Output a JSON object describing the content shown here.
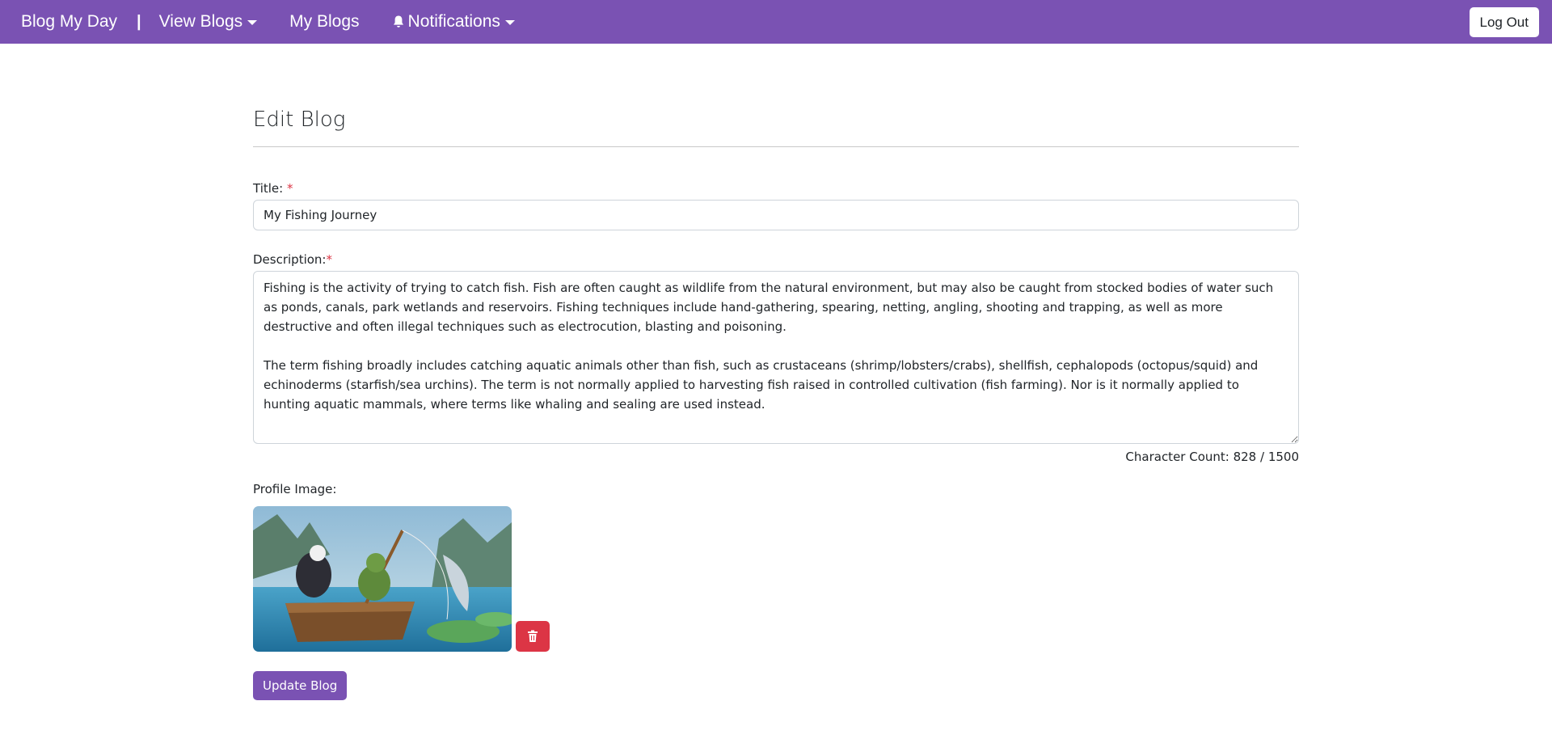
{
  "navbar": {
    "brand": "Blog My Day",
    "separator": "|",
    "view_blogs": "View Blogs",
    "my_blogs": "My Blogs",
    "notifications": "Notifications",
    "logout": "Log Out",
    "bg_color": "#7a52b3"
  },
  "page": {
    "title": "Edit Blog"
  },
  "form": {
    "title_label": "Title:",
    "required_mark": "*",
    "title_value": "My Fishing Journey",
    "description_label": "Description:",
    "description_value": "Fishing is the activity of trying to catch fish. Fish are often caught as wildlife from the natural environment, but may also be caught from stocked bodies of water such as ponds, canals, park wetlands and reservoirs. Fishing techniques include hand-gathering, spearing, netting, angling, shooting and trapping, as well as more destructive and often illegal techniques such as electrocution, blasting and poisoning.\n\nThe term fishing broadly includes catching aquatic animals other than fish, such as crustaceans (shrimp/lobsters/crabs), shellfish, cephalopods (octopus/squid) and echinoderms (starfish/sea urchins). The term is not normally applied to harvesting fish raised in controlled cultivation (fish farming). Nor is it normally applied to hunting aquatic mammals, where terms like whaling and sealing are used instead.",
    "char_count": "Character Count: 828 / 1500",
    "profile_image_label": "Profile Image:",
    "update_button": "Update Blog"
  },
  "icons": {
    "bell": "bell-icon",
    "trash": "trash-icon",
    "caret": "chevron-down-icon"
  },
  "colors": {
    "accent": "#7a52b3",
    "danger": "#dc3545"
  }
}
